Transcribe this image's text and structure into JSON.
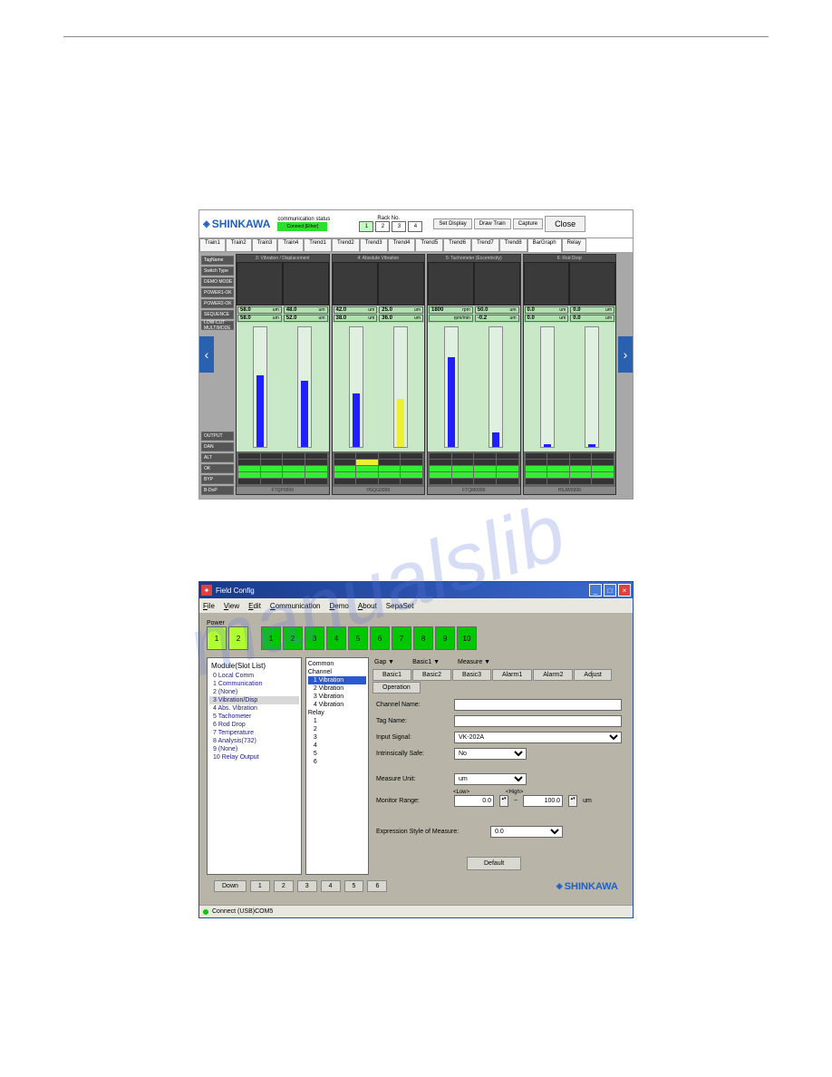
{
  "brand": "SHINKAWA",
  "fig1": {
    "comm_label": "communication status",
    "comm_status": "Connect [Ether]",
    "rack_label": "Rack No.",
    "rack_buttons": [
      "1",
      "2",
      "3",
      "4"
    ],
    "top_buttons": {
      "set_display": "Set Display",
      "draw_train": "Draw Train",
      "capture": "Capture",
      "close": "Close"
    },
    "tabs": [
      "Train1",
      "Train2",
      "Train3",
      "Train4",
      "Trend1",
      "Trend2",
      "Trend3",
      "Trend4",
      "Trend5",
      "Trend6",
      "Trend7",
      "Trend8",
      "BarGraph",
      "Relay"
    ],
    "side_labels": [
      "TagName",
      "Switch Type",
      "DEMO MODE",
      "POWER1-OK",
      "POWER2-OK",
      "SEQUENCE",
      "LOW-CUT MULTIMODE"
    ],
    "side_output_labels": [
      "OUTPUT",
      "DAN",
      "ALT",
      "OK",
      "BYP",
      "B-DoP"
    ],
    "modules": [
      {
        "title": "3: Vibration / Displacement",
        "foot": "FTQP0999",
        "vals": [
          [
            "58.0",
            "um",
            "58.0",
            "um"
          ],
          [
            "48.0",
            "um",
            "52.0",
            "um"
          ]
        ],
        "bars": [
          60,
          55
        ]
      },
      {
        "title": "4: Absolute Vibration",
        "foot": "HSQG0999",
        "vals": [
          [
            "42.0",
            "um",
            "38.0",
            "um"
          ],
          [
            "25.0",
            "um",
            "36.0",
            "um"
          ]
        ],
        "bars": [
          45,
          40
        ]
      },
      {
        "title": "5: Tachometer (Eccentricity)",
        "foot": "FTQM0999",
        "vals": [
          [
            "1800",
            "rpm",
            "",
            "rpm/min"
          ],
          [
            "50.0",
            "um",
            "-0.2",
            "um"
          ]
        ],
        "bars": [
          75,
          12
        ]
      },
      {
        "title": "6: Rod Drop",
        "foot": "HSJW0999",
        "vals": [
          [
            "0.0",
            "um",
            "0.0",
            "um"
          ],
          [
            "0.0",
            "um",
            "0.0",
            "um"
          ]
        ],
        "bars": [
          2,
          2
        ]
      }
    ]
  },
  "fig2": {
    "title": "Field Config",
    "menu": [
      "File",
      "View",
      "Edit",
      "Communication",
      "Demo",
      "About",
      "SepaSet"
    ],
    "power_label": "Power",
    "power_slots": [
      "1",
      "2"
    ],
    "green_slots": [
      "1",
      "2",
      "3",
      "4",
      "5",
      "6",
      "7",
      "8",
      "9",
      "10"
    ],
    "slot_list_title": "Module(Slot List)",
    "slot_list": [
      "0 Local Comm",
      "1 Communication",
      "2 (None)",
      "3 Vibration/Disp",
      "4 Abs. Vibration",
      "5 Tachometer",
      "6 Rod Drop",
      "7 Temperature",
      "8 Analysis(732)",
      "9 (None)",
      "10 Relay Output"
    ],
    "slot_selected": 3,
    "channel": {
      "common": "Common",
      "channel_hdr": "Channel",
      "items": [
        "1 Vibration",
        "2 Vibration",
        "3 Vibration",
        "4 Vibration"
      ],
      "selected": 0,
      "relay_hdr": "Relay",
      "relays": [
        "1",
        "2",
        "3",
        "4",
        "5",
        "6"
      ]
    },
    "legend": {
      "gap": "Gap ▼",
      "basic": "Basic1 ▼",
      "measure": "Measure ▼"
    },
    "sub_tabs": [
      "Basic1",
      "Basic2",
      "Basic3",
      "Alarm1",
      "Alarm2",
      "Adjust",
      "Operation"
    ],
    "form": {
      "channel_name_lbl": "Channel Name:",
      "channel_name": "",
      "tag_name_lbl": "Tag Name:",
      "tag_name": "",
      "input_signal_lbl": "Input Signal:",
      "input_signal": "VK-202A",
      "intrinsic_lbl": "Intrinsically Safe:",
      "intrinsic": "No",
      "measure_unit_lbl": "Measure Unit:",
      "measure_unit": "um",
      "monitor_range_lbl": "Monitor Range:",
      "range_low_lbl": "<Low>",
      "range_high_lbl": "<High>",
      "range_low": "0.0",
      "range_high": "100.0",
      "range_unit": "um",
      "expr_lbl": "Expression Style of Measure:",
      "expr": "0.0",
      "default_btn": "Default"
    },
    "bottom_buttons": [
      "Down",
      "1",
      "2",
      "3",
      "4",
      "5",
      "6"
    ],
    "status": "Connect (USB)COM5"
  }
}
